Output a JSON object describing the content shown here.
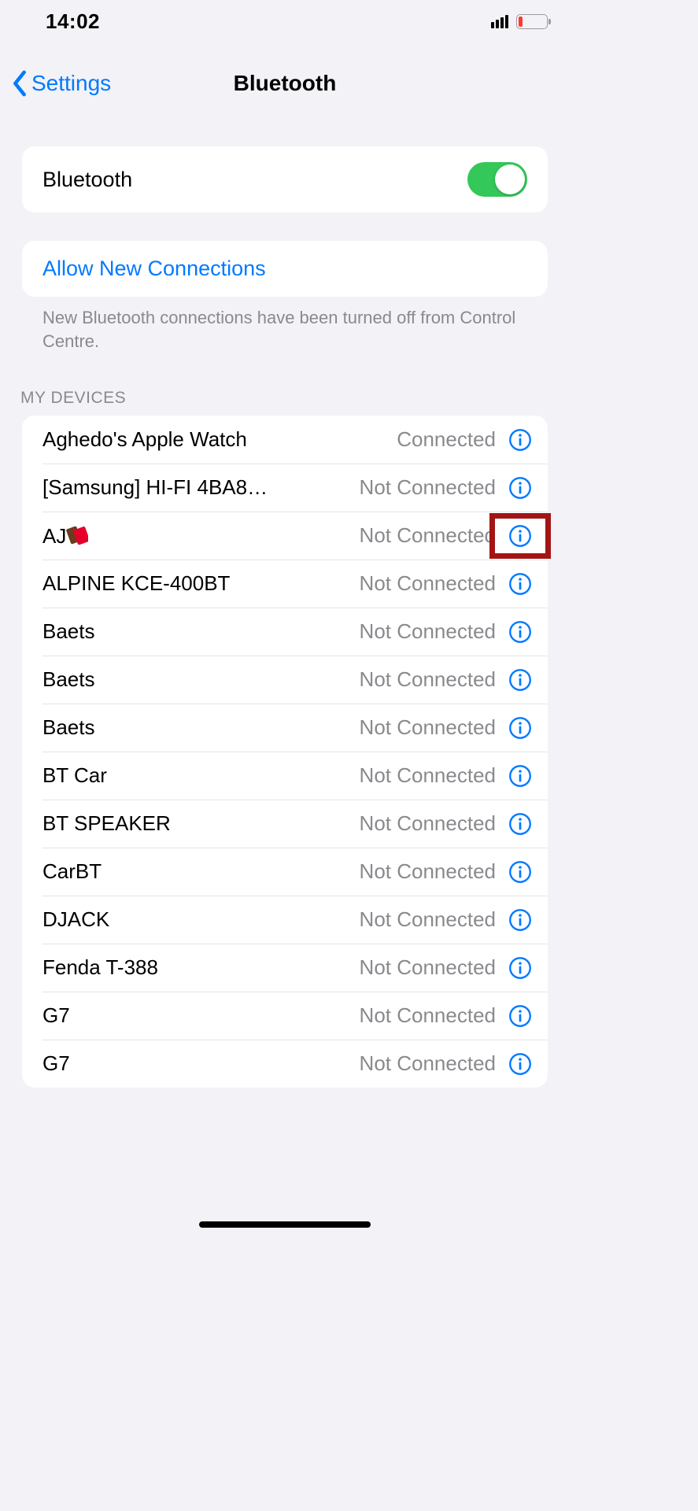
{
  "statusbar": {
    "time": "14:02"
  },
  "nav": {
    "back_label": "Settings",
    "title": "Bluetooth"
  },
  "toggle": {
    "label": "Bluetooth",
    "on": true
  },
  "allow": {
    "link": "Allow New Connections",
    "footer": "New Bluetooth connections have been turned off from Control Centre."
  },
  "list_header": "MY DEVICES",
  "devices": [
    {
      "name": "Aghedo's Apple Watch",
      "status": "Connected",
      "has_emoji": false
    },
    {
      "name": "[Samsung] HI-FI 4BA8…",
      "status": "Not Connected",
      "has_emoji": false
    },
    {
      "name": "AJ",
      "status": "Not Connected",
      "has_emoji": true
    },
    {
      "name": "ALPINE KCE-400BT",
      "status": "Not Connected",
      "has_emoji": false
    },
    {
      "name": "Baets",
      "status": "Not Connected",
      "has_emoji": false
    },
    {
      "name": "Baets",
      "status": "Not Connected",
      "has_emoji": false
    },
    {
      "name": "Baets",
      "status": "Not Connected",
      "has_emoji": false
    },
    {
      "name": "BT Car",
      "status": "Not Connected",
      "has_emoji": false
    },
    {
      "name": "BT SPEAKER",
      "status": "Not Connected",
      "has_emoji": false
    },
    {
      "name": "CarBT",
      "status": "Not Connected",
      "has_emoji": false
    },
    {
      "name": "DJACK",
      "status": "Not Connected",
      "has_emoji": false
    },
    {
      "name": "Fenda T-388",
      "status": "Not Connected",
      "has_emoji": false
    },
    {
      "name": "G7",
      "status": "Not Connected",
      "has_emoji": false
    },
    {
      "name": "G7",
      "status": "Not Connected",
      "has_emoji": false
    }
  ],
  "highlight_device_index": 2
}
